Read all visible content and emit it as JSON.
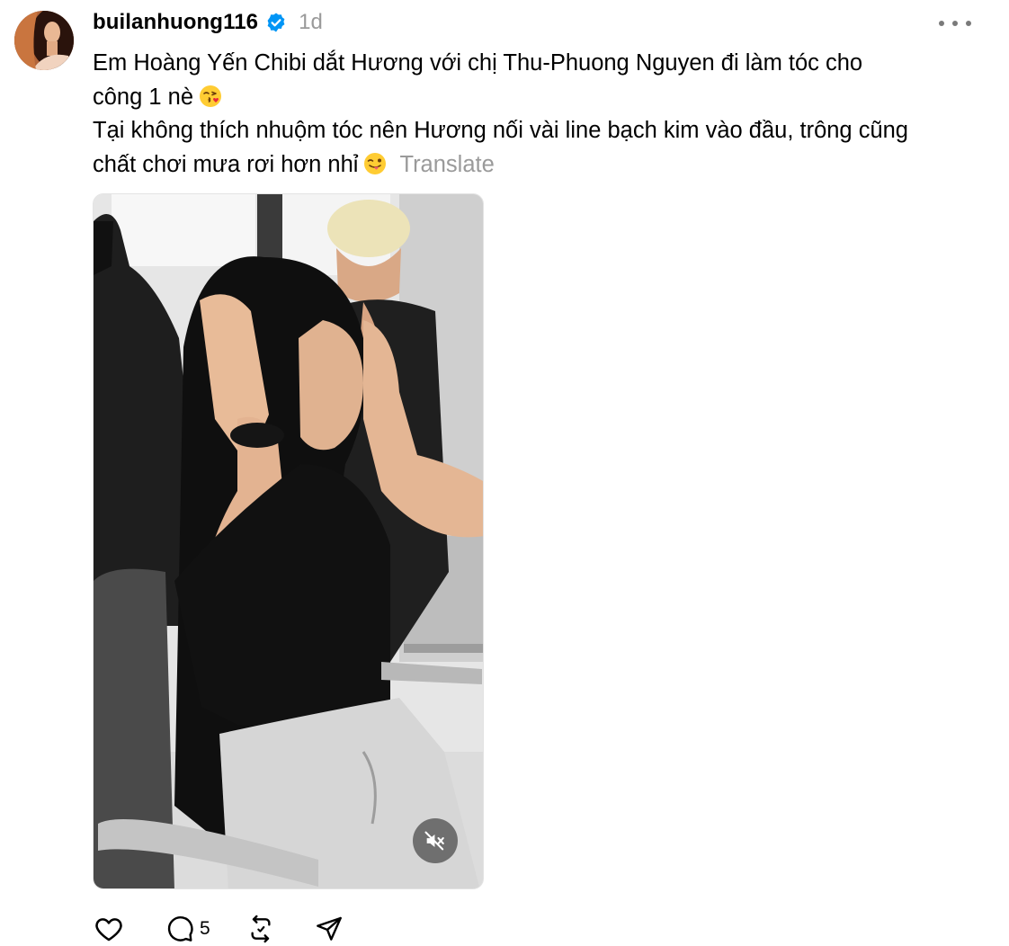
{
  "post": {
    "username": "builanhuong116",
    "verified": true,
    "time": "1d",
    "caption_lines": [
      "Em Hoàng Yến Chibi dắt Hương với chị Thu-Phuong Nguyen đi làm tóc cho",
      "công 1 nè",
      "Tại không thích nhuộm tóc nên Hương nối vài line bạch kim vào đầu, trông cũng",
      "chất chơi mưa rơi hơn nhỉ"
    ],
    "translate_label": "Translate",
    "reply_count": "5"
  },
  "icons": {
    "more": "more-options-icon",
    "verified": "verified-badge-icon",
    "kiss_emoji": "face-blowing-kiss-emoji",
    "wink_emoji": "winking-face-with-tongue-emoji",
    "mute": "speaker-muted-icon",
    "like": "heart-icon",
    "reply": "comment-bubble-icon",
    "repost": "repost-icon",
    "share": "send-icon"
  },
  "colors": {
    "text": "#000000",
    "muted": "#9a9a9a",
    "verified": "#0095f6"
  }
}
